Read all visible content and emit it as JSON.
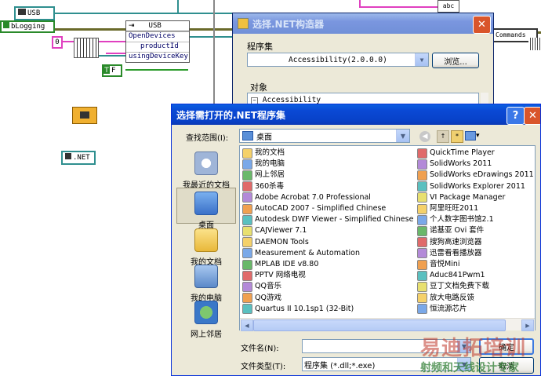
{
  "diagram": {
    "usb_ref_label": "USB",
    "blogging_label": "bLogging",
    "usb_node_title": "USB",
    "usb_node_rows": [
      "OpenDevices",
      "productId",
      "usingDeviceKey"
    ],
    "const_zero": "0",
    "bool_true": "T",
    "bool_false": "F",
    "dotnet_ref_label": ".NET",
    "commands_label": "Commands",
    "abc_label": "abc"
  },
  "dotnet_dialog": {
    "title": "选择.NET构造器",
    "assembly_label": "程序集",
    "assembly_value": "Accessibility(2.0.0.0)",
    "browse_button": "浏览...",
    "objects_label": "对象",
    "tree_item": "Accessibility"
  },
  "file_dialog": {
    "title": "选择需打开的.NET程序集",
    "look_in_label": "查找范围(I):",
    "look_in_value": "桌面",
    "places": [
      {
        "label": "我最近的文档",
        "icon": "recent-docs-icon"
      },
      {
        "label": "桌面",
        "icon": "desktop-icon"
      },
      {
        "label": "我的文档",
        "icon": "my-documents-icon"
      },
      {
        "label": "我的电脑",
        "icon": "my-computer-icon"
      },
      {
        "label": "网上邻居",
        "icon": "network-places-icon"
      }
    ],
    "files_col1": [
      "我的文档",
      "我的电脑",
      "网上邻居",
      "360杀毒",
      "Adobe Acrobat 7.0 Professional",
      "AutoCAD 2007 - Simplified Chinese",
      "Autodesk DWF Viewer - Simplified Chinese",
      "CAJViewer 7.1",
      "DAEMON Tools",
      "Measurement & Automation",
      "MPLAB IDE v8.80",
      "PPTV 网络电视",
      "QQ音乐",
      "QQ游戏",
      "Quartus II 10.1sp1 (32-Bit)"
    ],
    "files_col2": [
      "QuickTime Player",
      "SolidWorks 2011",
      "SolidWorks eDrawings 2011",
      "SolidWorks Explorer 2011",
      "VI Package Manager",
      "阿里旺旺2011",
      "个人数字图书馆2.1",
      "诺基亚 Ovi 套件",
      "搜狗高速浏览器",
      "迅雷看看播放器",
      "音悦Mini",
      "Aduc841Pwm1",
      "豆丁文档免费下载",
      "放大电路反馈",
      "恒流源芯片"
    ],
    "filename_label": "文件名(N):",
    "filename_value": "",
    "filetype_label": "文件类型(T):",
    "filetype_value": "程序集 (*.dll;*.exe)",
    "ok_button": "确定",
    "cancel_button": "取消"
  },
  "watermark": {
    "line1": "易迪拓培训",
    "line2": "射频和天线设计专家"
  },
  "colors": {
    "xp_title_active": "#0a49d5",
    "xp_title_inactive": "#7a96df",
    "dialog_face": "#ece9d8",
    "watermark_red": "#c0392b",
    "watermark_green": "#2e7d32"
  }
}
